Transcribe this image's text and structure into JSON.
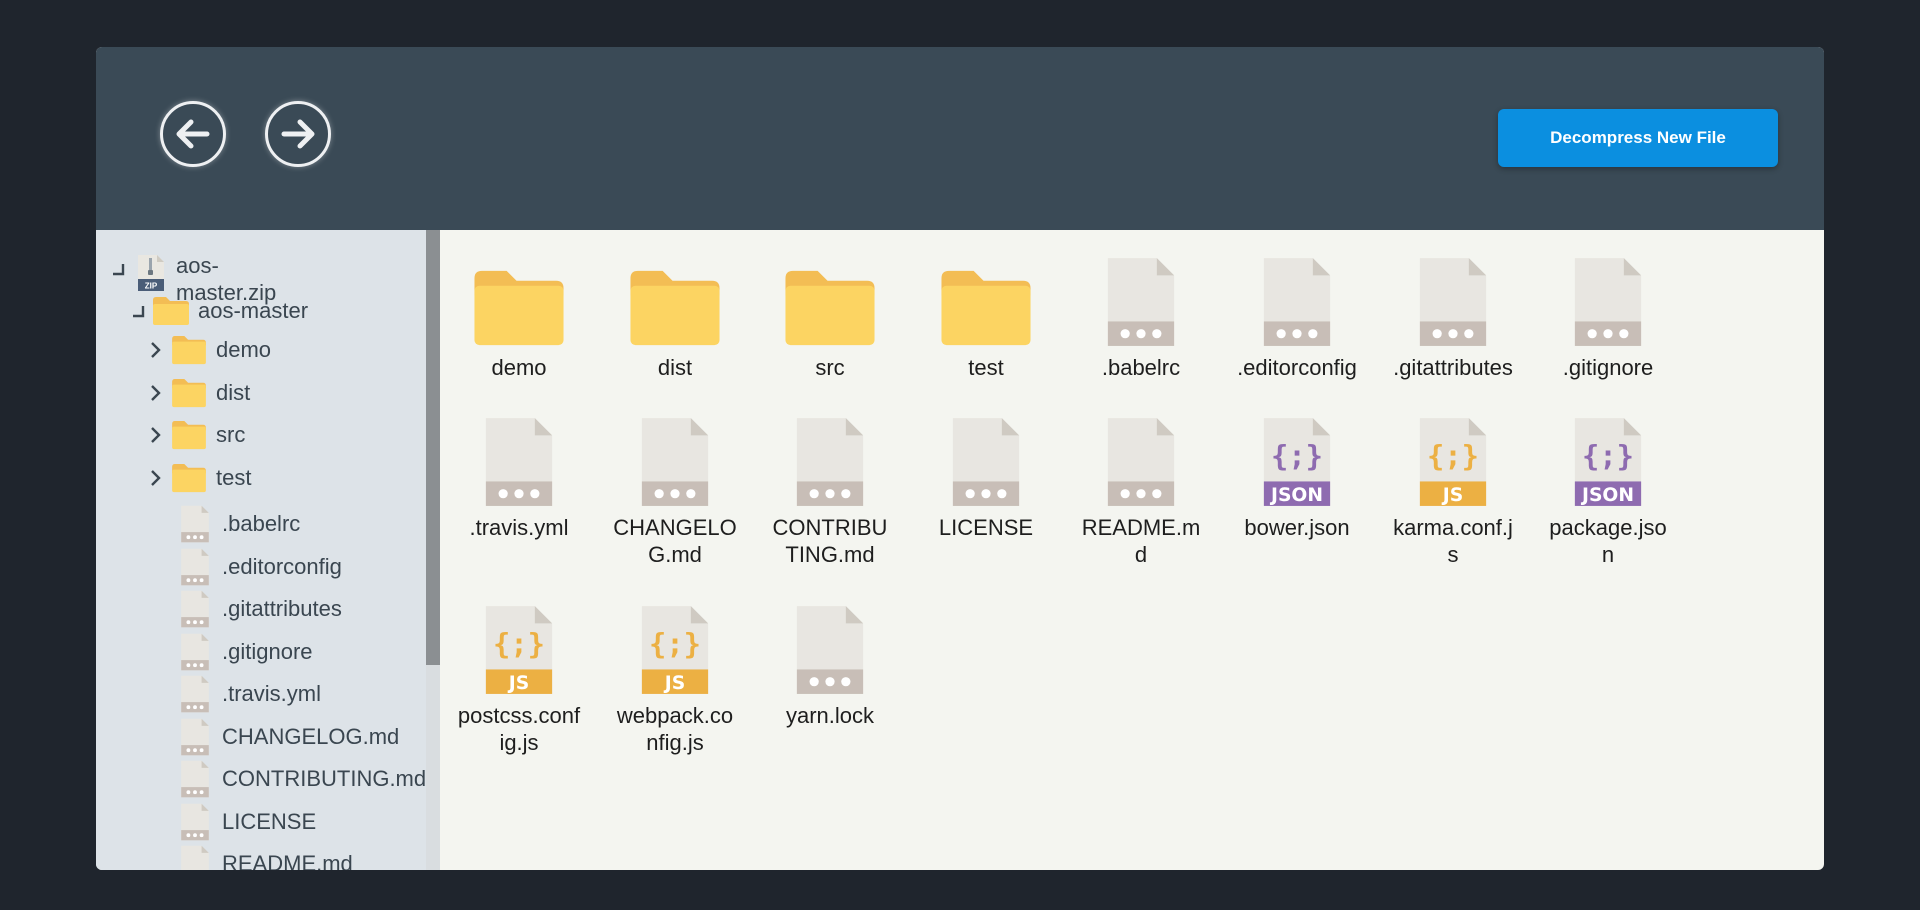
{
  "header": {
    "back_icon": "arrow-left-circle-icon",
    "forward_icon": "arrow-right-circle-icon",
    "decompress_label": "Decompress New File"
  },
  "colors": {
    "header_bg": "#3a4a56",
    "accent": "#0b8fe0",
    "sidebar_bg": "#dde3e8",
    "folder": "#fcd462",
    "json_badge": "#8e6bb0",
    "js_badge": "#ecb043",
    "generic_badge": "#c7bdb7"
  },
  "tree": {
    "root_label": "aos-master.zip",
    "root_line1": "aos-",
    "root_line2": "master.zip",
    "folder_label": "aos-master",
    "items": [
      {
        "label": "demo",
        "type": "folder"
      },
      {
        "label": "dist",
        "type": "folder"
      },
      {
        "label": "src",
        "type": "folder"
      },
      {
        "label": "test",
        "type": "folder"
      },
      {
        "label": ".babelrc",
        "type": "file"
      },
      {
        "label": ".editorconfig",
        "type": "file"
      },
      {
        "label": ".gitattributes",
        "type": "file"
      },
      {
        "label": ".gitignore",
        "type": "file"
      },
      {
        "label": ".travis.yml",
        "type": "file"
      },
      {
        "label": "CHANGELOG.md",
        "type": "file"
      },
      {
        "label": "CONTRIBUTING.md",
        "type": "file"
      },
      {
        "label": "LICENSE",
        "type": "file"
      },
      {
        "label": "README.md",
        "type": "file"
      }
    ]
  },
  "files": [
    {
      "name": "demo",
      "icon": "folder"
    },
    {
      "name": "dist",
      "icon": "folder"
    },
    {
      "name": "src",
      "icon": "folder"
    },
    {
      "name": "test",
      "icon": "folder"
    },
    {
      "name": ".babelrc",
      "icon": "file"
    },
    {
      "name": ".editorconfig",
      "icon": "file"
    },
    {
      "name": ".gitattributes",
      "icon": "file"
    },
    {
      "name": ".gitignore",
      "icon": "file"
    },
    {
      "name": ".travis.yml",
      "icon": "file"
    },
    {
      "name": "CHANGELOG.md",
      "icon": "file"
    },
    {
      "name": "CONTRIBUTING.md",
      "icon": "file"
    },
    {
      "name": "LICENSE",
      "icon": "file"
    },
    {
      "name": "README.md",
      "icon": "file"
    },
    {
      "name": "bower.json",
      "icon": "json"
    },
    {
      "name": "karma.conf.js",
      "icon": "js"
    },
    {
      "name": "package.json",
      "icon": "json"
    },
    {
      "name": "postcss.config.js",
      "icon": "js"
    },
    {
      "name": "webpack.config.js",
      "icon": "js"
    },
    {
      "name": "yarn.lock",
      "icon": "file"
    }
  ],
  "badges": {
    "json": "JSON",
    "js": "JS",
    "zip": "ZIP",
    "braces": "{;}"
  }
}
